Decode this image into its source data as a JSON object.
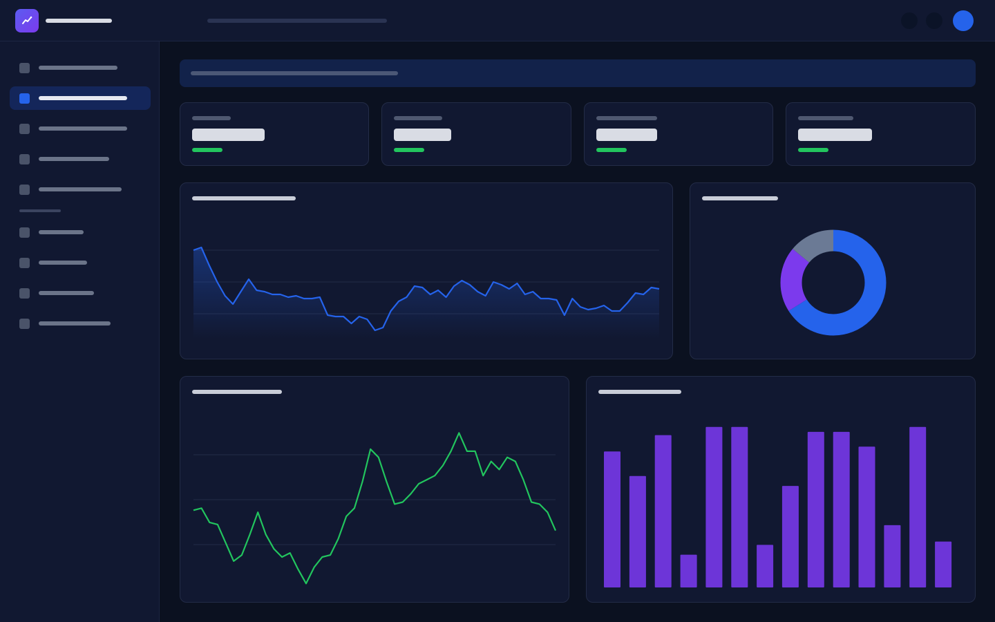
{
  "colors": {
    "accent": "#2563eb",
    "accent_active_bg": "#14265a",
    "positive": "#22c55e",
    "purple": "#6d35d8",
    "violet": "#7c3aed",
    "gray": "#6b7a95"
  },
  "header": {
    "logo_icon": "trend-line-icon",
    "actions": [
      "circle-icon",
      "circle-icon"
    ],
    "avatar_color": "#2563eb"
  },
  "sidebar": {
    "active_index": 1,
    "item_icon": "square-icon"
  },
  "stats": [
    {
      "delta_color": "#22c55e"
    },
    {
      "delta_color": "#22c55e"
    },
    {
      "delta_color": "#22c55e"
    },
    {
      "delta_color": "#22c55e"
    }
  ],
  "chart_data": [
    {
      "type": "area",
      "series": [
        {
          "values": [
            64,
            66,
            53,
            41,
            31,
            25,
            34,
            43,
            35,
            34,
            32,
            32,
            30,
            31,
            29,
            29,
            30,
            17,
            16,
            16,
            11,
            16,
            14,
            6,
            8,
            20,
            27,
            30,
            38,
            37,
            32,
            35,
            30,
            38,
            42,
            39,
            34,
            31,
            41,
            39,
            36,
            40,
            32,
            34,
            29,
            29,
            28,
            17,
            29,
            23,
            21,
            22,
            24,
            20,
            20,
            26,
            33,
            32,
            37,
            36
          ]
        }
      ],
      "ylim": [
        0,
        75
      ],
      "grid": true
    },
    {
      "type": "pie",
      "series": [
        {
          "values": [
            66,
            20,
            14
          ]
        }
      ],
      "colors": [
        "#2563eb",
        "#7c3aed",
        "#6b7a95"
      ]
    },
    {
      "type": "line",
      "series": [
        {
          "values": [
            26,
            27,
            20,
            19,
            10,
            1,
            4,
            14,
            25,
            14,
            7,
            3,
            5,
            -3,
            -10,
            -2,
            3,
            4,
            12,
            23,
            27,
            40,
            56,
            52,
            40,
            29,
            30,
            34,
            39,
            41,
            43,
            48,
            55,
            64,
            55,
            55,
            43,
            50,
            46,
            52,
            50,
            41,
            30,
            29,
            25,
            16
          ]
        }
      ],
      "ylim": [
        -15,
        75
      ],
      "grid": true
    },
    {
      "type": "bar",
      "values": [
        83,
        68,
        93,
        20,
        98,
        98,
        26,
        62,
        95,
        95,
        86,
        38,
        98,
        28
      ],
      "ylim": [
        0,
        100
      ]
    }
  ]
}
